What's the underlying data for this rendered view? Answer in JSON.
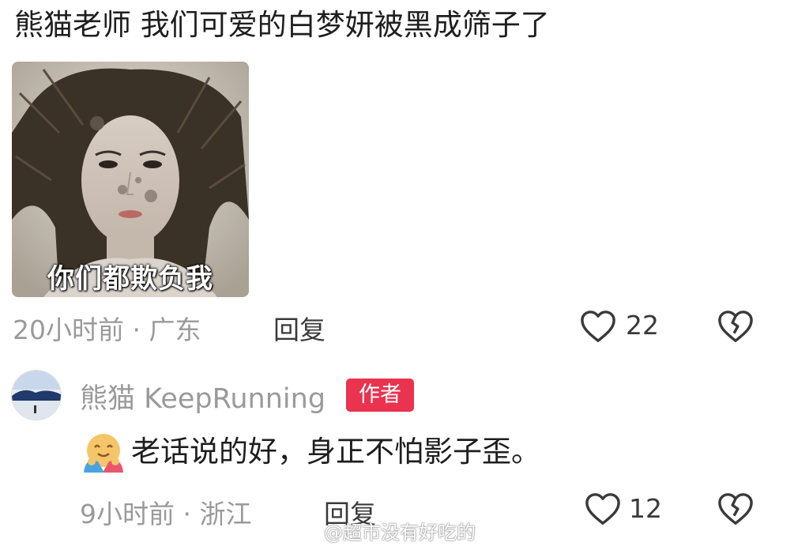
{
  "comment": {
    "text": "熊猫老师 我们可爱的白梦妍被黑成筛子了",
    "sticker_caption": "你们都欺负我",
    "time_location": "20小时前 · 广东",
    "reply_label": "回复",
    "like_count": "22"
  },
  "reply": {
    "username": "熊猫 KeepRunning",
    "badge": "作者",
    "text": "老话说的好，身正不怕影子歪。",
    "time_location": "9小时前 · 浙江",
    "reply_label": "回复",
    "like_count": "12"
  },
  "watermark": "@超市没有好吃的",
  "icons": {
    "like": "heart-outline-icon",
    "dislike": "broken-heart-icon",
    "emoji": "hugging-face-icon"
  },
  "colors": {
    "badge": "#e9334f",
    "meta_text": "#9a9a9a"
  }
}
